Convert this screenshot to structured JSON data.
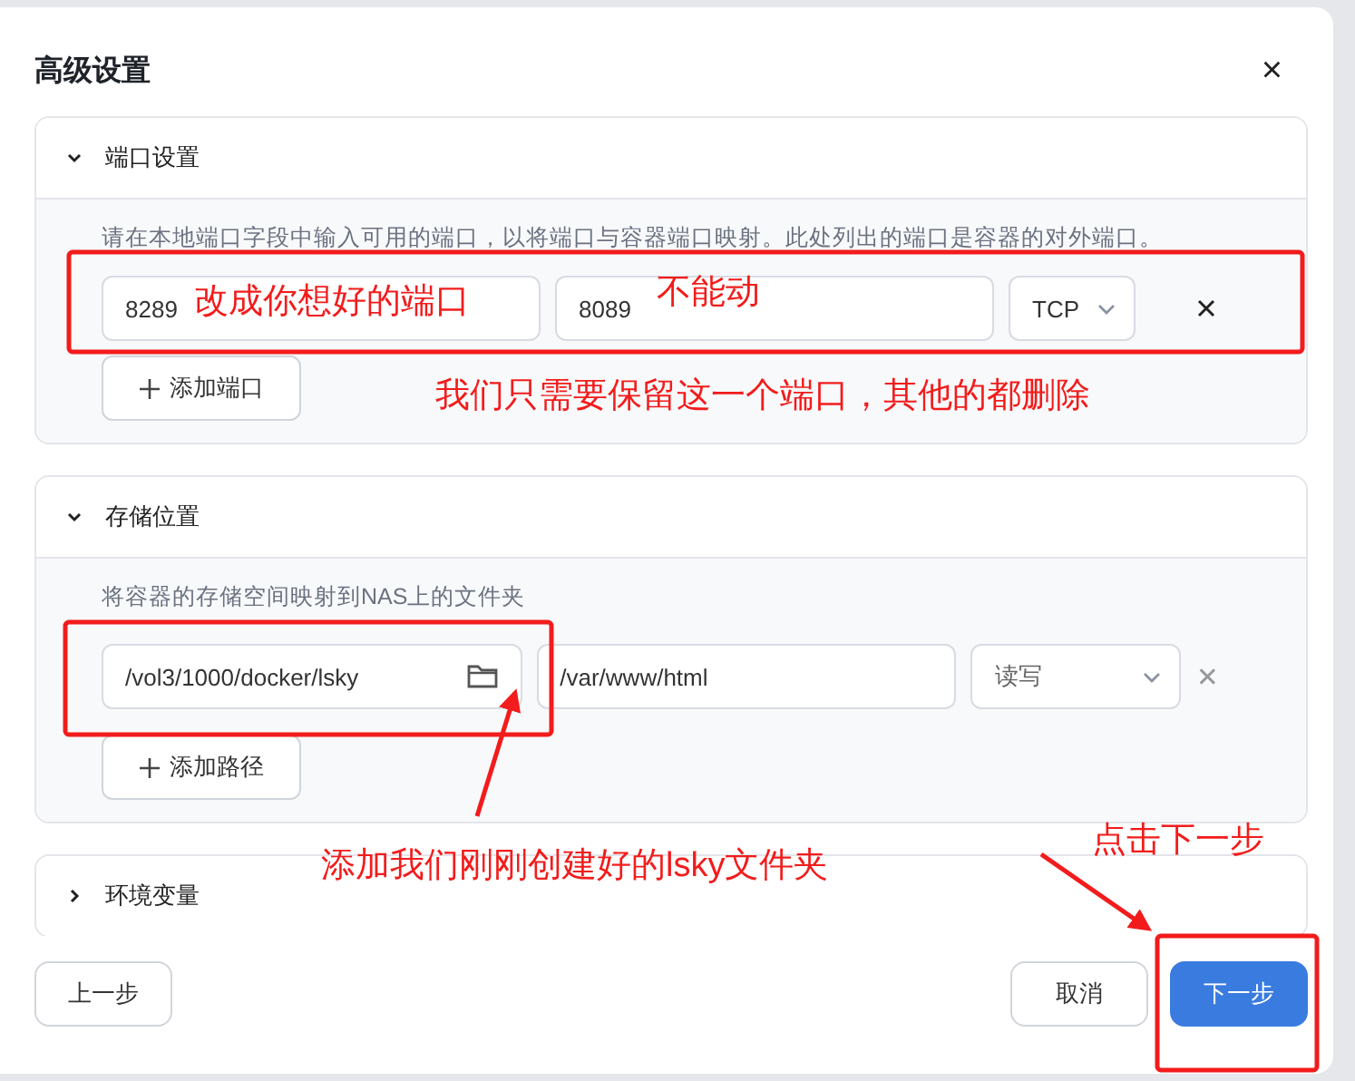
{
  "dialog": {
    "title": "高级设置",
    "close": "×"
  },
  "sections": [
    {
      "kind": "ports",
      "title": "端口设置",
      "expanded": true,
      "hint": "请在本地端口字段中输入可用的端口，以将端口与容器端口映射。此处列出的端口是容器的对外端口。",
      "rows": [
        {
          "local": "8289",
          "container": "8089",
          "option": "TCP"
        }
      ],
      "add": "添加端口"
    },
    {
      "kind": "volumes",
      "title": "存储位置",
      "expanded": true,
      "hint": "将容器的存储空间映射到NAS上的文件夹",
      "rows": [
        {
          "local": "/vol3/1000/docker/lsky",
          "container": "/var/www/html",
          "option": "读写"
        }
      ],
      "add": "添加路径"
    },
    {
      "kind": "env",
      "title": "环境变量",
      "expanded": false
    }
  ],
  "footer": {
    "back": "上一步",
    "cancel": "取消",
    "next": "下一步"
  },
  "annotations": [
    {
      "text": "改成你想好的端口"
    },
    {
      "text": "不能动"
    },
    {
      "text": "我们只需要保留这一个端口，其他的都删除"
    },
    {
      "text": "添加我们刚刚创建好的lsky文件夹"
    },
    {
      "text": "点击下一步"
    }
  ]
}
